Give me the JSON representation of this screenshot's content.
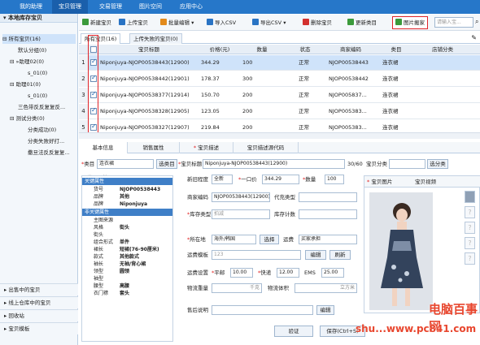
{
  "topnav": {
    "items": [
      "我的助理",
      "宝贝管理",
      "交易管理",
      "图片空间",
      "应用中心"
    ],
    "active_index": 1
  },
  "sidebar": {
    "header": "本地库存宝贝",
    "tree": [
      {
        "label": "所有宝贝(16)",
        "level": 0,
        "selected": true
      },
      {
        "label": "默认分组(0)",
        "level": 2
      },
      {
        "label": "»助理02(0)",
        "level": 1
      },
      {
        "label": "s_01(0)",
        "level": 3
      },
      {
        "label": "助理01(0)",
        "level": 1
      },
      {
        "label": "s_01(0)",
        "level": 3
      },
      {
        "label": "三色带反反复复反...",
        "level": 2
      },
      {
        "label": "测试分类(0)",
        "level": 1
      },
      {
        "label": "分类成功(0)",
        "level": 3
      },
      {
        "label": "分类失败好打...",
        "level": 3
      },
      {
        "label": "撒旦法反反复复...",
        "level": 3
      }
    ],
    "bottom_items": [
      "出售中的宝贝",
      "线上仓库中的宝贝",
      "回收站",
      "宝贝模板"
    ]
  },
  "toolbar": {
    "buttons": [
      {
        "label": "新建宝贝",
        "icon": "new-item-icon",
        "color": "#3b9a3b"
      },
      {
        "label": "上传宝贝",
        "icon": "upload-icon",
        "color": "#2a74c4"
      },
      {
        "label": "批量编辑",
        "icon": "batch-edit-icon",
        "color": "#e28a1b"
      },
      {
        "label": "导入CSV",
        "icon": "import-icon",
        "color": "#2a74c4"
      },
      {
        "label": "导出CSV",
        "icon": "export-icon",
        "color": "#2a74c4"
      },
      {
        "label": "删除宝贝",
        "icon": "delete-icon",
        "color": "#d3312f"
      },
      {
        "label": "更新类目",
        "icon": "refresh-icon",
        "color": "#3b9a3b"
      },
      {
        "label": "图片搬家",
        "icon": "image-move-icon",
        "color": "#3b9a3b"
      }
    ],
    "search_placeholder": "请输入宝..."
  },
  "tabs": {
    "items": [
      "所有宝贝(16)",
      "上传失败的宝贝(0)"
    ]
  },
  "grid": {
    "columns": [
      "宝贝标题",
      "价格(元)",
      "数量",
      "状态",
      "商家编码",
      "类目",
      "店铺分类"
    ],
    "rows": [
      {
        "num": "1",
        "title": "Niponjuya-NJOP00538443(12900)",
        "price": "344.29",
        "qty": "100",
        "status": "正常",
        "code": "NJOP00538443",
        "cat": "连衣裙",
        "checked": true,
        "selected": true
      },
      {
        "num": "2",
        "title": "Niponjuya-NJOP00538442(12901)",
        "price": "178.37",
        "qty": "300",
        "status": "正常",
        "code": "NJOP00538442",
        "cat": "连衣裙",
        "checked": true
      },
      {
        "num": "3",
        "title": "Niponjuya-NJOP00538377(12914)",
        "price": "150.70",
        "qty": "200",
        "status": "正常",
        "code": "NJOP005837...",
        "cat": "连衣裙",
        "checked": true
      },
      {
        "num": "4",
        "title": "Niponjuya-NJOP00538328(12905)",
        "price": "123.05",
        "qty": "200",
        "status": "正常",
        "code": "NJOP005383...",
        "cat": "连衣裙",
        "checked": true
      },
      {
        "num": "5",
        "title": "Niponjuya-NJOP00538327(12907)",
        "price": "219.84",
        "qty": "200",
        "status": "正常",
        "code": "NJOP005383...",
        "cat": "连衣裙",
        "checked": true
      }
    ]
  },
  "subtabs": {
    "items": [
      "基本信息",
      "销售属性",
      "宝贝描述",
      "宝贝描述源代码"
    ],
    "active_index": 0
  },
  "form": {
    "category_label": "类目",
    "category_value": "连衣裙",
    "category_button": "选类目",
    "title_label": "宝贝标题",
    "title_value": "Niponjuya-NJOP00538443(12900)",
    "title_counter": "30/60",
    "shop_cat_label": "宝贝分类",
    "shop_cat_button": "选分类",
    "attr_header": "类目属性",
    "condition_label": "新旧程度",
    "condition_value": "全新",
    "price_label": "一口价",
    "price_value": "344.29",
    "qty_label": "数量",
    "qty_value": "100",
    "code_label": "商家编码",
    "code_value": "NJOP00538443(12900)",
    "agent_label": "代充类型",
    "stock_type_label": "库存类型",
    "stock_type_value": "拍减",
    "stock_count_label": "库存计数",
    "location_label": "所在地",
    "location_value": "海外/韩国",
    "location_button": "选择",
    "freight_label": "运费",
    "freight_value": "买家承担",
    "template_label": "运费模板",
    "template_value": "123",
    "edit_button": "编辑",
    "refresh_button": "刷新",
    "ship_label": "运费设置",
    "ship_normal": "平邮",
    "ship_normal_value": "10.00",
    "ship_express": "快递",
    "ship_express_value": "12.00",
    "ship_ems": "EMS",
    "ship_ems_value": "25.00",
    "weight_label": "物流重量",
    "weight_unit": "千克",
    "volume_label": "物流体积",
    "volume_unit": "立方米",
    "aftersale_label": "售后说明",
    "aftersale_button": "编辑",
    "verify_button": "验证",
    "save_button": "保存(Ctrl+S)"
  },
  "attributes": [
    {
      "k": "",
      "v": "关键属性",
      "section": true
    },
    {
      "k": "货号",
      "v": "NJOP00538443"
    },
    {
      "k": "品牌",
      "v": "其他"
    },
    {
      "k": "品牌",
      "v": "Niponjuya"
    },
    {
      "k": "",
      "v": "非关键属性",
      "section": true
    },
    {
      "k": "主图来源",
      "v": ""
    },
    {
      "k": "风格",
      "v": "街头"
    },
    {
      "k": "街头",
      "v": ""
    },
    {
      "k": "组合形式",
      "v": "单件"
    },
    {
      "k": "裙长",
      "v": "短裙(76-90厘米)"
    },
    {
      "k": "款式",
      "v": "其他款式"
    },
    {
      "k": "袖长",
      "v": "无袖/背心裙"
    },
    {
      "k": "领型",
      "v": "圆领"
    },
    {
      "k": "袖型",
      "v": ""
    },
    {
      "k": "腰型",
      "v": "高腰"
    },
    {
      "k": "衣门襟",
      "v": "套头"
    }
  ],
  "images": {
    "tabs": [
      "宝贝图片",
      "宝贝视频"
    ],
    "thumb_placeholder": "?"
  },
  "watermark": {
    "line1": "电脑百事网",
    "line2": "shu...www.pc841.com"
  }
}
